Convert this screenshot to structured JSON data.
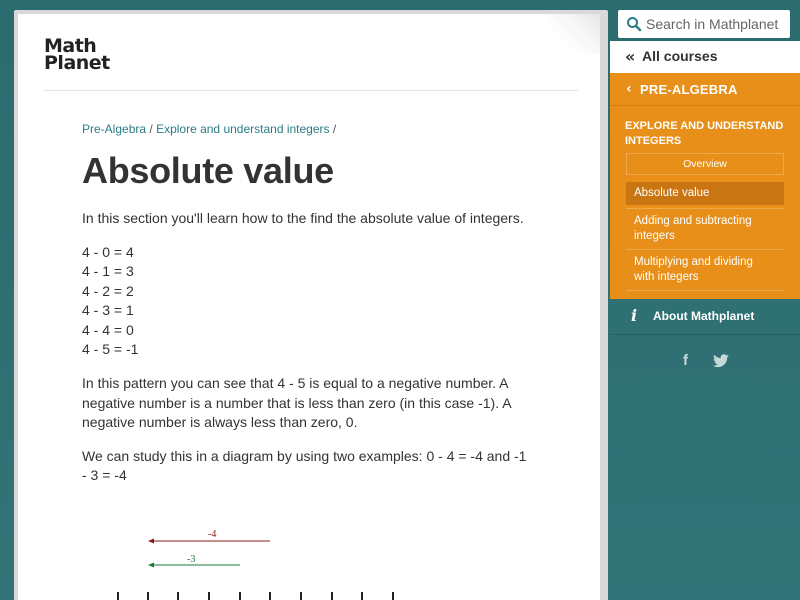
{
  "logo": {
    "line1": "Math",
    "line2": "Planet"
  },
  "breadcrumb": [
    {
      "label": "Pre-Algebra"
    },
    {
      "label": "Explore and understand integers"
    }
  ],
  "breadcrumb_sep": "/",
  "page_title": "Absolute value",
  "content": {
    "intro": "In this section you'll learn how to the find the absolute value of integers.",
    "equations": [
      "4 - 0 = 4",
      "4 - 1 = 3",
      "4 - 2 = 2",
      "4 - 3 = 1",
      "4 - 4 = 0",
      "4 - 5 = -1"
    ],
    "para1": "In this pattern you can see that 4 - 5 is equal to a negative number. A negative number is a number that is less than zero (in this case -1). A negative number is always less than zero, 0.",
    "para2": "We can study this in a diagram by using two examples:  0 - 4 = -4 and -1 - 3 = -4"
  },
  "diagram": {
    "arrow1_label": "-4",
    "arrow2_label": "-3",
    "arrow1_color": "#8b1a1a",
    "arrow2_color": "#1a7a3a"
  },
  "sidebar": {
    "search_placeholder": "Search in Mathplanet",
    "all_courses": "All courses",
    "course": "PRE-ALGEBRA",
    "section": "EXPLORE AND UNDERSTAND INTEGERS",
    "overview": "Overview",
    "items": [
      {
        "label": "Absolute value",
        "active": true
      },
      {
        "label": "Adding and subtracting integers",
        "active": false
      },
      {
        "label": "Multiplying and dividing with integers",
        "active": false
      }
    ],
    "about": "About Mathplanet",
    "facebook_glyph": "f"
  },
  "colors": {
    "teal_bg": "#2f6f72",
    "orange": "#e88f19",
    "link": "#2a7d86"
  }
}
